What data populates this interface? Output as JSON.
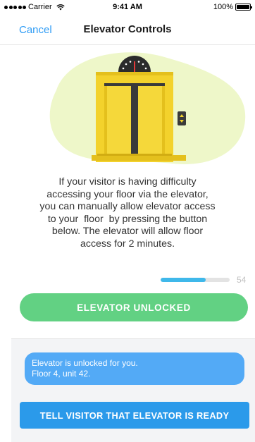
{
  "status_bar": {
    "carrier": "Carrier",
    "time": "9:41 AM",
    "battery": "100%",
    "icons": [
      "signal-icon",
      "wifi-icon",
      "battery-icon"
    ]
  },
  "nav": {
    "cancel_label": "Cancel",
    "title": "Elevator Controls"
  },
  "illustration": {
    "name": "elevator-illustration",
    "colors": {
      "blob": "#eef7c9",
      "elevator": "#f3d22c",
      "frame": "#e4c01d",
      "door_line": "#3a3a3a",
      "indicator": "#2b2b2b"
    }
  },
  "message": {
    "lines": [
      "If your visitor is having difficulty",
      "accessing your floor via the elevator,",
      "you can manually allow elevator access",
      "to your  floor  by pressing the button",
      "below. The elevator will allow floor",
      "access for 2 minutes."
    ]
  },
  "timer": {
    "remaining_seconds": "54",
    "progress_fraction": 0.65,
    "fill_color": "#3fb8ea"
  },
  "unlock_button": {
    "label": "ELEVATOR UNLOCKED",
    "color": "#62d183"
  },
  "compose": {
    "bubble_lines": [
      "Elevator is unlocked for you.",
      "Floor 4, unit 42."
    ],
    "bubble_color": "#53aaf6",
    "send_label": "TELL VISITOR THAT ELEVATOR IS READY",
    "send_color": "#2b9aea"
  }
}
